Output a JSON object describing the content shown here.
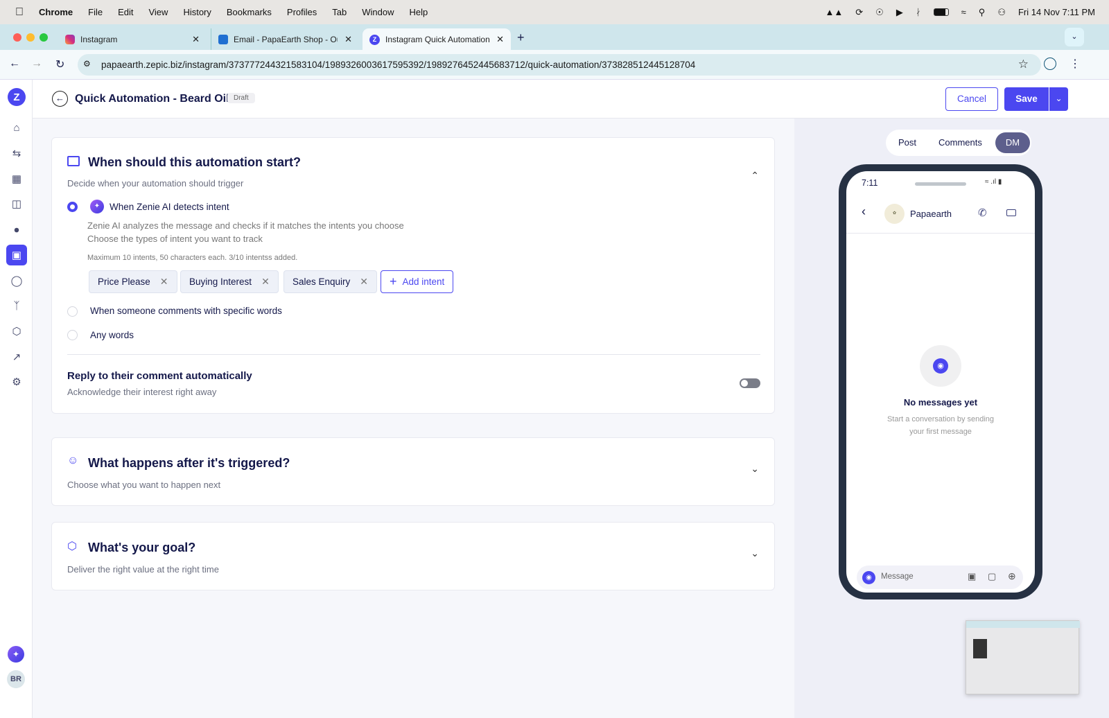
{
  "menubar": {
    "app": "Chrome",
    "items": [
      "File",
      "Edit",
      "View",
      "History",
      "Bookmarks",
      "Profiles",
      "Tab",
      "Window",
      "Help"
    ],
    "datetime": "Fri 14 Nov  7:11 PM"
  },
  "tabs": [
    {
      "title": "Instagram"
    },
    {
      "title": "Email - PapaEarth Shop - Out"
    },
    {
      "title": "Instagram Quick Automation"
    }
  ],
  "address": {
    "url": "papaearth.zepic.biz/instagram/373777244321583104/1989326003617595392/1989276452445683712/quick-automation/373828512445128704"
  },
  "header": {
    "title": "Quick Automation - Beard Oil",
    "status": "Draft",
    "cancel": "Cancel",
    "save": "Save"
  },
  "trigger": {
    "title": "When should this automation start?",
    "subtitle": "Decide when your automation should trigger",
    "option_ai": "When Zenie AI detects intent",
    "ai_desc1": "Zenie AI analyzes the message and checks if it matches the intents you choose",
    "ai_desc2": "Choose the types of intent you want to track",
    "limit_note": "Maximum 10 intents, 50 characters each. 3/10 intentss added.",
    "intents": [
      "Price Please",
      "Buying Interest",
      "Sales Enquiry"
    ],
    "add_intent": "Add intent",
    "option_words": "When someone comments with specific words",
    "option_any": "Any words",
    "reply_title": "Reply to their comment automatically",
    "reply_sub": "Acknowledge their interest right away",
    "reply_enabled": false
  },
  "after": {
    "title": "What happens after it's triggered?",
    "subtitle": "Choose what you want to happen next"
  },
  "goal": {
    "title": "What's your goal?",
    "subtitle": "Deliver the right value at the right time"
  },
  "preview": {
    "tabs": [
      "Post",
      "Comments",
      "DM"
    ],
    "active_tab": "DM",
    "phone": {
      "time": "7:11",
      "contact": "Papaearth",
      "empty_title": "No messages yet",
      "empty_sub1": "Start a conversation by sending",
      "empty_sub2": "your first message",
      "input_placeholder": "Message"
    }
  },
  "user": {
    "initials": "BR"
  },
  "colors": {
    "accent": "#4b47f0",
    "dark": "#14184a"
  }
}
